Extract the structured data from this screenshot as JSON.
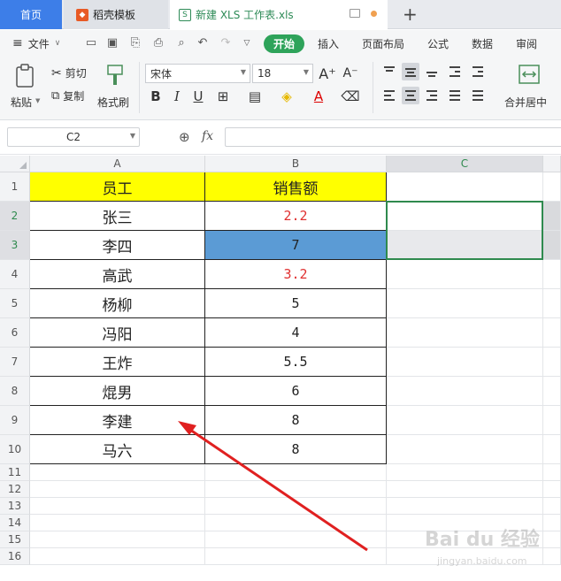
{
  "tabs": {
    "home": "首页",
    "template": "稻壳模板",
    "file": "新建 XLS 工作表.xls",
    "new_tab": "+"
  },
  "menu": {
    "file": "文件",
    "start": "开始",
    "items": [
      "插入",
      "页面布局",
      "公式",
      "数据",
      "审阅"
    ]
  },
  "ribbon": {
    "paste": "粘贴",
    "cut": "剪切",
    "copy": "复制",
    "format_painter": "格式刷",
    "font_name": "宋体",
    "font_size": "18",
    "bold": "B",
    "italic": "I",
    "underline": "U",
    "merge_center": "合并居中"
  },
  "formula_bar": {
    "name_box": "C2",
    "fx": "fx",
    "value": ""
  },
  "sheet": {
    "columns": [
      "A",
      "B",
      "C"
    ],
    "rows": [
      "1",
      "2",
      "3",
      "4",
      "5",
      "6",
      "7",
      "8",
      "9",
      "10",
      "11",
      "12",
      "13",
      "14",
      "15",
      "16"
    ],
    "header": [
      "员工",
      "销售额"
    ],
    "data": [
      {
        "name": "张三",
        "sales": "2.2"
      },
      {
        "name": "李四",
        "sales": "7"
      },
      {
        "name": "高武",
        "sales": "3.2"
      },
      {
        "name": "杨柳",
        "sales": "5"
      },
      {
        "name": "冯阳",
        "sales": "4"
      },
      {
        "name": "王炸",
        "sales": "5.5"
      },
      {
        "name": "焜男",
        "sales": "6"
      },
      {
        "name": "李建",
        "sales": "8"
      },
      {
        "name": "马六",
        "sales": "8"
      }
    ],
    "active_cell": "C2"
  },
  "colors": {
    "header_fill": "#ffff00",
    "highlight_fill": "#5b9bd5",
    "red_text": "#e03030",
    "accent": "#2ea35a",
    "arrow": "#e02020"
  },
  "watermark": {
    "brand": "Bai du 经验",
    "url": "jingyan.baidu.com"
  }
}
